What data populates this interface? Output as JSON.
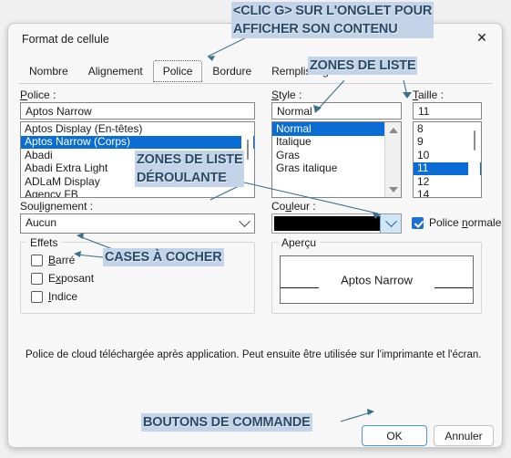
{
  "dialog": {
    "title": "Format de cellule",
    "close_icon": "close-icon"
  },
  "tabs": [
    {
      "label": "Nombre",
      "selected": false
    },
    {
      "label": "Alignement",
      "selected": false
    },
    {
      "label": "Police",
      "selected": true
    },
    {
      "label": "Bordure",
      "selected": false
    },
    {
      "label": "Remplissage",
      "selected": false
    }
  ],
  "font": {
    "label": "Police :",
    "label_prefix": "P",
    "label_rest": "olice :",
    "value": "Aptos Narrow",
    "items": [
      {
        "label": "Aptos Display (En-têtes)",
        "selected": false
      },
      {
        "label": "Aptos Narrow (Corps)",
        "selected": true
      },
      {
        "label": "Abadi",
        "selected": false
      },
      {
        "label": "Abadi Extra Light",
        "selected": false
      },
      {
        "label": "ADLaM Display",
        "selected": false
      },
      {
        "label": "Agency FB",
        "selected": false
      }
    ]
  },
  "style": {
    "label": "Style :",
    "value": "Normal",
    "items": [
      {
        "label": "Normal",
        "selected": true
      },
      {
        "label": "Italique",
        "selected": false
      },
      {
        "label": "Gras",
        "selected": false
      },
      {
        "label": "Gras italique",
        "selected": false
      }
    ]
  },
  "size": {
    "label": "Taille :",
    "value": "11",
    "items": [
      {
        "label": "8",
        "selected": false
      },
      {
        "label": "9",
        "selected": false
      },
      {
        "label": "10",
        "selected": false
      },
      {
        "label": "11",
        "selected": true
      },
      {
        "label": "12",
        "selected": false
      },
      {
        "label": "14",
        "selected": false
      }
    ]
  },
  "underline": {
    "label": "Soulignement :",
    "value": "Aucun"
  },
  "color": {
    "label": "Couleur :",
    "value_hex": "#000000"
  },
  "normal_font": {
    "label": "Police normale",
    "checked": true
  },
  "effects": {
    "title": "Effets",
    "items": [
      {
        "label": "Barré",
        "checked": false
      },
      {
        "label": "Exposant",
        "checked": false
      },
      {
        "label": "Indice",
        "checked": false
      }
    ]
  },
  "preview": {
    "title": "Aperçu",
    "sample_text": "Aptos Narrow"
  },
  "info": {
    "text": "Police de cloud téléchargée après application. Peut ensuite être utilisée sur l'imprimante et l'écran."
  },
  "footer": {
    "ok_label": "OK",
    "cancel_label": "Annuler"
  },
  "annotations": {
    "tab_hint_line1": "<CLIC G> SUR L'ONGLET POUR",
    "tab_hint_line2": "AFFICHER SON CONTENU",
    "list_zones": "ZONES DE LISTE",
    "dropdown_zones_line1": "ZONES DE LISTE",
    "dropdown_zones_line2": "DÉROULANTE",
    "checkboxes": "CASES À COCHER",
    "command_buttons": "BOUTONS DE COMMANDE"
  },
  "colors": {
    "annotation_text": "#2c4a66",
    "annotation_highlight": "#c3d4e8",
    "selection_blue": "#0a6cd4",
    "accent_blue": "#1f6fd0"
  }
}
